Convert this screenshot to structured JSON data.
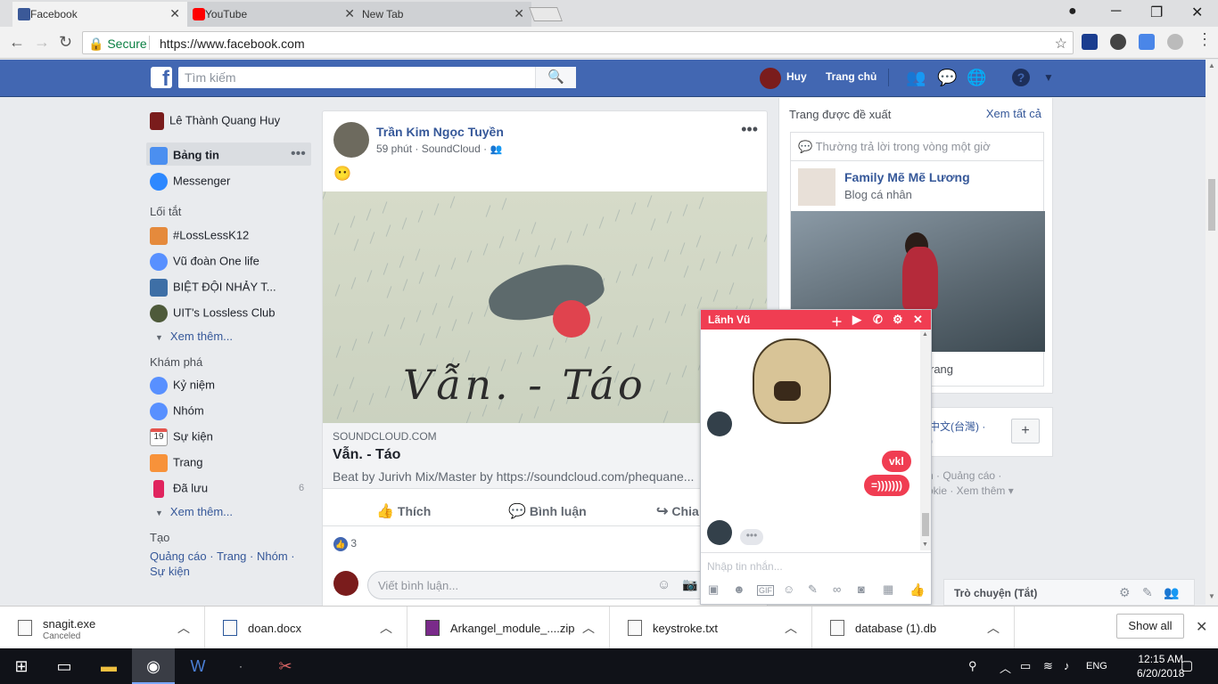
{
  "browser": {
    "tabs": [
      {
        "title": "Facebook",
        "icon": "facebook-icon",
        "active": true
      },
      {
        "title": "YouTube",
        "icon": "youtube-icon",
        "active": false
      },
      {
        "title": "New Tab",
        "icon": "",
        "active": false
      }
    ],
    "secure_label": "Secure",
    "url": "https://www.facebook.com"
  },
  "header": {
    "search_placeholder": "Tìm kiếm",
    "user_name": "Huy",
    "home_label": "Trang chủ"
  },
  "left_nav": {
    "profile": "Lê Thành Quang Huy",
    "news_feed": "Bảng tin",
    "messenger": "Messenger",
    "shortcuts_title": "Lối tắt",
    "shortcuts": [
      "#LossLessK12",
      "Vũ đoàn One life",
      "BIỆT ĐỘI NHẢY T...",
      "UIT's Lossless Club"
    ],
    "see_more": "Xem thêm...",
    "explore_title": "Khám phá",
    "explore": [
      {
        "label": "Kỷ niệm",
        "count": ""
      },
      {
        "label": "Nhóm",
        "count": ""
      },
      {
        "label": "Sự kiện",
        "count": ""
      },
      {
        "label": "Trang",
        "count": ""
      },
      {
        "label": "Đã lưu",
        "count": "6"
      }
    ],
    "calendar_day": "19",
    "create_title": "Tạo",
    "create_links": [
      "Quảng cáo",
      "Trang",
      "Nhóm",
      "Sự kiện"
    ]
  },
  "post": {
    "author": "Trần Kim Ngọc Tuyền",
    "meta": "59 phút · SoundCloud ·",
    "emoji": "😶",
    "image_text": "Vẫn. - Táo",
    "link_domain": "SOUNDCLOUD.COM",
    "link_title": "Vẫn. - Táo",
    "link_desc": "Beat by Jurivh Mix/Master by https://soundcloud.com/phequane...",
    "like_label": "Thích",
    "comment_label": "Bình luận",
    "share_label": "Chia",
    "like_count": "3",
    "comment_placeholder": "Viết bình luận..."
  },
  "right_column": {
    "title": "Trang được đề xuất",
    "see_all": "Xem tất cả",
    "response": "Thường trả lời trong vòng một giờ",
    "page_name": "Family Mẽ Mẽ Lương",
    "page_category": "Blog cá nhân",
    "like_page_partial": "rang",
    "lang_partial": "中文(台灣) ·",
    "lang_partial2": ")",
    "footer_line1": "n · Quảng cáo ·",
    "footer_line2": "okie · Xem thêm ▾"
  },
  "chat": {
    "name": "Lãnh Vũ",
    "messages": [
      "vkl",
      "=)))))))"
    ],
    "typing": "•••",
    "input_placeholder": "Nhập tin nhắn..."
  },
  "chat_bar": {
    "label": "Trò chuyện (Tắt)"
  },
  "downloads": [
    {
      "name": "snagit.exe",
      "status": "Canceled"
    },
    {
      "name": "doan.docx",
      "status": ""
    },
    {
      "name": "Arkangel_module_....zip",
      "status": ""
    },
    {
      "name": "keystroke.txt",
      "status": ""
    },
    {
      "name": "database (1).db",
      "status": ""
    }
  ],
  "show_all": "Show all",
  "taskbar": {
    "lang": "ENG",
    "time": "12:15 AM",
    "date": "6/20/2018"
  },
  "colors": {
    "fb_blue": "#4267b2",
    "messenger_red": "#f03d52",
    "link_blue": "#365899"
  }
}
